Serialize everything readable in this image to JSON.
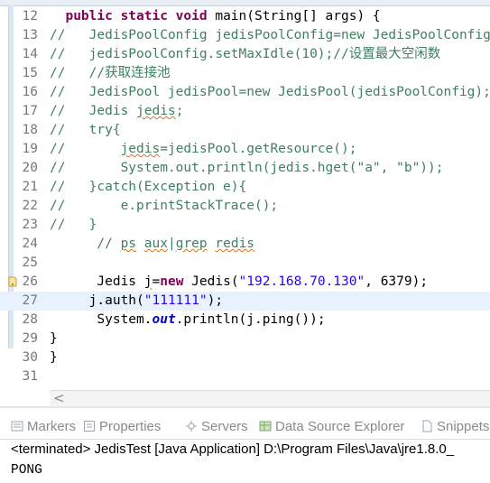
{
  "editor": {
    "lines": [
      {
        "num": "12",
        "segments": [
          {
            "t": "  ",
            "c": ""
          },
          {
            "t": "public static void",
            "c": "kw"
          },
          {
            "t": " main(String[] args) {",
            "c": ""
          }
        ]
      },
      {
        "num": "13",
        "segments": [
          {
            "t": "//   JedisPoolConfig jedisPoolConfig=new JedisPoolConfig();",
            "c": "cm"
          }
        ]
      },
      {
        "num": "14",
        "segments": [
          {
            "t": "//   jedisPoolConfig.setMaxIdle(10);//设置最大空闲数",
            "c": "cm"
          }
        ]
      },
      {
        "num": "15",
        "segments": [
          {
            "t": "//   //获取连接池",
            "c": "cm"
          }
        ]
      },
      {
        "num": "16",
        "segments": [
          {
            "t": "//   JedisPool jedisPool=new JedisPool(jedisPoolConfig);",
            "c": "cm"
          }
        ]
      },
      {
        "num": "17",
        "segments": [
          {
            "t": "//   Jedis ",
            "c": "cm"
          },
          {
            "t": "jedis",
            "c": "cm sq"
          },
          {
            "t": ";",
            "c": "cm"
          }
        ]
      },
      {
        "num": "18",
        "segments": [
          {
            "t": "//   try{",
            "c": "cm"
          }
        ]
      },
      {
        "num": "19",
        "segments": [
          {
            "t": "//       ",
            "c": "cm"
          },
          {
            "t": "jedis",
            "c": "cm sq"
          },
          {
            "t": "=jedisPool.getResource();",
            "c": "cm"
          }
        ]
      },
      {
        "num": "20",
        "segments": [
          {
            "t": "//       System.out.println(jedis.hget(\"a\", \"b\"));",
            "c": "cm"
          }
        ]
      },
      {
        "num": "21",
        "segments": [
          {
            "t": "//   }catch(Exception e){",
            "c": "cm"
          }
        ]
      },
      {
        "num": "22",
        "segments": [
          {
            "t": "//       e.printStackTrace();",
            "c": "cm"
          }
        ]
      },
      {
        "num": "23",
        "segments": [
          {
            "t": "//   }",
            "c": "cm"
          }
        ]
      },
      {
        "num": "24",
        "segments": [
          {
            "t": "      // ",
            "c": "cm"
          },
          {
            "t": "ps",
            "c": "cm sq"
          },
          {
            "t": " ",
            "c": "cm"
          },
          {
            "t": "aux",
            "c": "cm sq"
          },
          {
            "t": "|",
            "c": "cm"
          },
          {
            "t": "grep",
            "c": "cm sq"
          },
          {
            "t": " ",
            "c": "cm"
          },
          {
            "t": "redis",
            "c": "cm sq"
          }
        ]
      },
      {
        "num": "25",
        "segments": []
      },
      {
        "num": "26",
        "warn": true,
        "segments": [
          {
            "t": "      Jedis ",
            "c": ""
          },
          {
            "t": "j",
            "c": "sq"
          },
          {
            "t": "=",
            "c": ""
          },
          {
            "t": "new",
            "c": "kw"
          },
          {
            "t": " Jedis(",
            "c": ""
          },
          {
            "t": "\"192.168.70.130\"",
            "c": "str"
          },
          {
            "t": ", 6379);",
            "c": ""
          }
        ]
      },
      {
        "num": "27",
        "current": true,
        "segments": [
          {
            "t": "     j.auth(",
            "c": ""
          },
          {
            "t": "\"111111\"",
            "c": "str"
          },
          {
            "t": ");",
            "c": ""
          }
        ]
      },
      {
        "num": "28",
        "segments": [
          {
            "t": "      System.",
            "c": ""
          },
          {
            "t": "out",
            "c": "fld"
          },
          {
            "t": ".println(j.ping());",
            "c": ""
          }
        ]
      },
      {
        "num": "29",
        "segments": [
          {
            "t": "}",
            "c": ""
          }
        ]
      },
      {
        "num": "30",
        "segments": [
          {
            "t": "}",
            "c": ""
          }
        ]
      },
      {
        "num": "31",
        "segments": []
      }
    ]
  },
  "scrollbar": {
    "arrow_left": "<"
  },
  "console": {
    "tabs": [
      {
        "label": "Markers",
        "icon": "markers-icon"
      },
      {
        "label": "Properties",
        "icon": "properties-icon"
      },
      {
        "label": "Servers",
        "icon": "servers-icon"
      },
      {
        "label": "Data Source Explorer",
        "icon": "data-source-explorer-icon"
      },
      {
        "label": "Snippets",
        "icon": "snippets-icon"
      }
    ],
    "header": "<terminated> JedisTest [Java Application] D:\\Program Files\\Java\\jre1.8.0_",
    "output": "PONG"
  },
  "colors": {
    "keyword": "#7f0055",
    "comment": "#3f7f5f",
    "string": "#2a00ff",
    "field": "#0000c0",
    "current_line": "#e8f2fe",
    "line_number": "#787878"
  }
}
